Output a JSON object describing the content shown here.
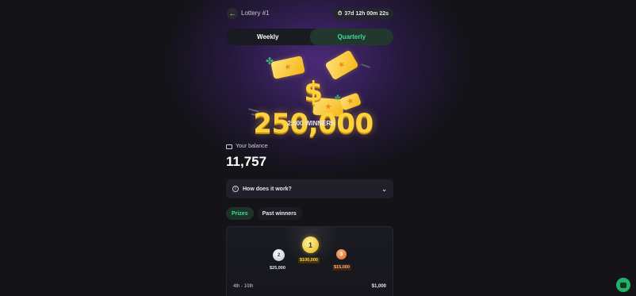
{
  "header": {
    "title": "Lottery #1",
    "timer": "37d 12h 00m 22s"
  },
  "period_tabs": [
    "Weekly",
    "Quarterly"
  ],
  "hero": {
    "prize": "$ 250,000",
    "winners": "2,500 WINNERS"
  },
  "balance": {
    "label": "Your balance",
    "value": "11,757"
  },
  "how": {
    "label": "How does it work?"
  },
  "sub_tabs": [
    "Prizes",
    "Past winners"
  ],
  "prizes": {
    "first": {
      "rank": "1",
      "amount": "$100,000"
    },
    "second": {
      "rank": "2",
      "amount": "$25,000"
    },
    "third": {
      "rank": "3",
      "amount": "$15,000"
    },
    "range_row": {
      "label": "4th - 10th",
      "amount": "$1,000"
    }
  },
  "icons": {
    "back": "arrow-left-icon",
    "timer": "stopwatch-icon",
    "wallet": "wallet-icon",
    "info": "info-icon",
    "chevron": "chevron-down-icon",
    "chat": "chat-icon"
  },
  "colors": {
    "accent_green": "#3ddc97",
    "gold": "#ffd23d",
    "background": "#131318"
  }
}
